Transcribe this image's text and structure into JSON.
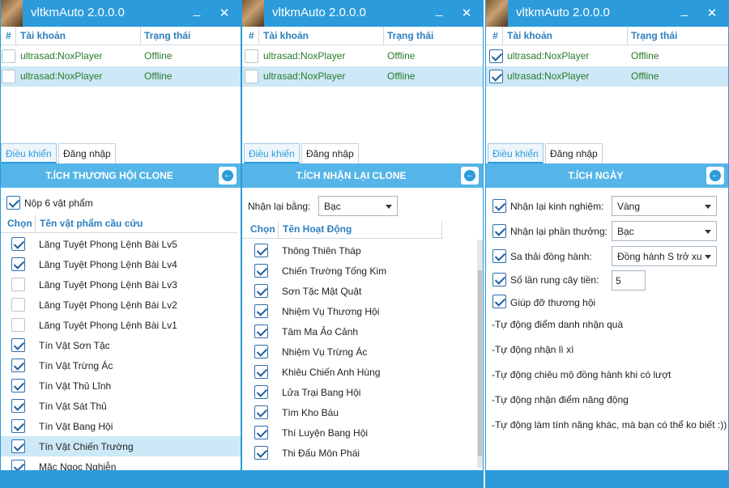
{
  "app_title": "vltkmAuto 2.0.0.0",
  "grid": {
    "col_hash": "#",
    "col_account": "Tài khoản",
    "col_status": "Trạng thái",
    "rows": [
      {
        "account": "ultrasad:NoxPlayer",
        "status": "Offline"
      },
      {
        "account": "ultrasad:NoxPlayer",
        "status": "Offline"
      }
    ]
  },
  "tabs": {
    "control": "Điều khiển",
    "login": "Đăng nhập"
  },
  "window1": {
    "panel_title": "T.Ích Thương Hội Clone",
    "submit_label": "Nộp 6 vật phẩm",
    "submit_checked": true,
    "col_choose": "Chọn",
    "col_item": "Tên vật phẩm cầu cứu",
    "items": [
      {
        "name": "Lăng Tuyệt Phong Lệnh Bài Lv5",
        "checked": true
      },
      {
        "name": "Lăng Tuyệt Phong Lệnh Bài Lv4",
        "checked": true
      },
      {
        "name": "Lăng Tuyệt Phong Lệnh Bài Lv3",
        "checked": false
      },
      {
        "name": "Lăng Tuyệt Phong Lệnh Bài Lv2",
        "checked": false
      },
      {
        "name": "Lăng Tuyệt Phong Lệnh Bài Lv1",
        "checked": false
      },
      {
        "name": "Tín Vật Sơn Tặc",
        "checked": true
      },
      {
        "name": "Tín Vật Trừng Ác",
        "checked": true
      },
      {
        "name": "Tín Vật Thủ Lĩnh",
        "checked": true
      },
      {
        "name": "Tín Vật Sát Thủ",
        "checked": true
      },
      {
        "name": "Tín Vật Bang Hội",
        "checked": true
      },
      {
        "name": "Tín Vật Chiến Trường",
        "checked": true
      },
      {
        "name": "Mặc Ngọc Nghiễn",
        "checked": true
      }
    ]
  },
  "window2": {
    "panel_title": "T.Ích Nhận Lại Clone",
    "receive_label": "Nhận lại bằng:",
    "receive_value": "Bạc",
    "col_choose": "Chọn",
    "col_activity": "Tên Hoạt Động",
    "items": [
      {
        "name": "Thông Thiên Tháp",
        "checked": true
      },
      {
        "name": "Chiến Trường Tống Kim",
        "checked": true
      },
      {
        "name": "Sơn Tặc Mật Quật",
        "checked": true
      },
      {
        "name": "Nhiệm Vụ Thương Hội",
        "checked": true
      },
      {
        "name": "Tâm Ma Ảo Cảnh",
        "checked": true
      },
      {
        "name": "Nhiệm Vụ Trừng Ác",
        "checked": true
      },
      {
        "name": "Khiêu Chiến Anh Hùng",
        "checked": true
      },
      {
        "name": "Lửa Trại Bang Hội",
        "checked": true
      },
      {
        "name": "Tìm Kho Báu",
        "checked": true
      },
      {
        "name": "Thí Luyện Bang Hội",
        "checked": true
      },
      {
        "name": "Thi Đấu Môn Phái",
        "checked": true
      }
    ]
  },
  "window3": {
    "panel_title": "T.Ích Ngày",
    "exp_label": "Nhận lại kinh nghiệm:",
    "exp_value": "Vàng",
    "reward_label": "Nhận lại phần thưởng:",
    "reward_value": "Bạc",
    "companion_label": "Sa thải đồng hành:",
    "companion_value": "Đồng hành S trở xuống",
    "shake_label": "Số lần rung cây tiền:",
    "shake_value": "5",
    "guild_help_label": "Giúp đỡ thương hội",
    "notes": [
      "-Tự động điểm danh nhận quà",
      "-Tự động nhận lì xì",
      "-Tự động chiêu mộ đồng hành khi có lượt",
      "-Tự động nhận điểm năng động",
      "-Tự động làm tính năng khác, mà bạn có thể ko biết :))"
    ]
  }
}
